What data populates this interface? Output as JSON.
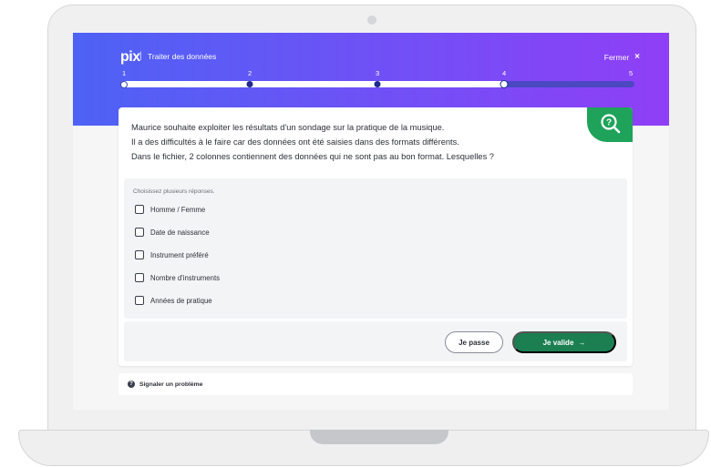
{
  "header": {
    "brand": "pix",
    "separator": "|",
    "title": "Traiter des données",
    "close_label": "Fermer",
    "close_icon": "×"
  },
  "progress": {
    "steps": [
      "1",
      "2",
      "3",
      "4",
      "5"
    ],
    "current": 4,
    "total": 5
  },
  "question": {
    "lines": [
      "Maurice souhaite exploiter les résultats d'un sondage sur la pratique de la musique.",
      "Il a des difficultés à le faire car des données ont été saisies dans des formats différents.",
      "Dans le fichier, 2 colonnes contiennent des données qui ne sont pas au bon format. Lesquelles ?"
    ]
  },
  "answers": {
    "hint": "Choisissez plusieurs réponses.",
    "options": [
      "Homme / Femme",
      "Date de naissance",
      "Instrument préféré",
      "Nombre d'instruments",
      "Années de pratique"
    ]
  },
  "buttons": {
    "skip": "Je passe",
    "validate": "Je valide",
    "validate_arrow": "→"
  },
  "report": {
    "icon": "?",
    "label": "Signaler un problème"
  },
  "colors": {
    "hero_start": "#4d62f5",
    "hero_end": "#8f3ff6",
    "validate_green": "#1b7f52",
    "badge_green": "#1fa35a"
  }
}
